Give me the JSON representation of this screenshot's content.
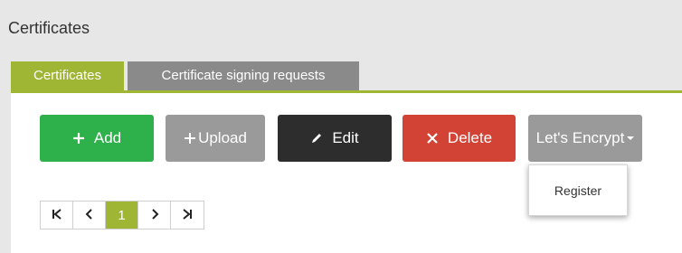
{
  "page": {
    "title": "Certificates"
  },
  "tabs": [
    {
      "label": "Certificates",
      "active": true
    },
    {
      "label": "Certificate signing requests",
      "active": false
    }
  ],
  "toolbar": {
    "add_label": "Add",
    "upload_label": "Upload",
    "edit_label": "Edit",
    "delete_label": "Delete",
    "letsencrypt_label": "Let's Encrypt"
  },
  "dropdown": {
    "items": [
      {
        "label": "Register"
      }
    ]
  },
  "pagination": {
    "current_page": "1"
  },
  "colors": {
    "accent": "#9fb534",
    "add": "#2eb14a",
    "neutral": "#9a9a9a",
    "edit": "#2d2d2d",
    "delete": "#d34335"
  },
  "icons": {
    "add": "plus-icon",
    "upload": "plus-icon",
    "edit": "pencil-icon",
    "delete": "x-icon",
    "letsencrypt": "caret-down-icon",
    "first": "first-page-icon",
    "prev": "chevron-left-icon",
    "next": "chevron-right-icon",
    "last": "last-page-icon"
  }
}
